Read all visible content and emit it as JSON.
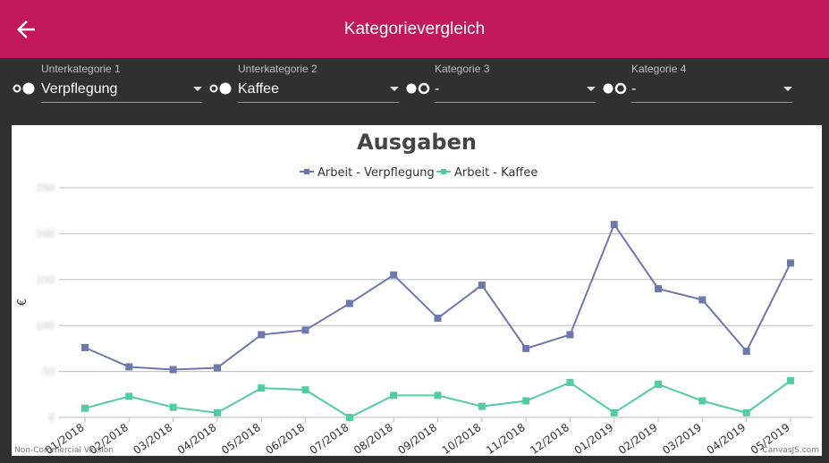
{
  "appbar": {
    "title": "Kategorievergleich",
    "back_icon": "arrow-left-icon",
    "color": "#c2185b"
  },
  "filters": [
    {
      "label": "Unterkategorie 1",
      "value": "Verpflegung",
      "active": true
    },
    {
      "label": "Unterkategorie 2",
      "value": "Kaffee",
      "active": true
    },
    {
      "label": "Kategorie 3",
      "value": "-",
      "active": false
    },
    {
      "label": "Kategorie 4",
      "value": "-",
      "active": false
    }
  ],
  "footer": {
    "left": "Non-Commercial Version",
    "right": "CanvasJS.com"
  },
  "chart_data": {
    "type": "line",
    "title": "Ausgaben",
    "ylabel": "€",
    "categories": [
      "01/2018",
      "02/2018",
      "03/2018",
      "04/2018",
      "05/2018",
      "06/2018",
      "07/2018",
      "08/2018",
      "09/2018",
      "10/2018",
      "11/2018",
      "12/2018",
      "01/2019",
      "02/2019",
      "03/2019",
      "04/2019",
      "05/2019"
    ],
    "ylim": [
      0,
      250
    ],
    "yticks": [
      0,
      50,
      100,
      150,
      200,
      250
    ],
    "ytick_labels_visible": false,
    "grid": true,
    "legend_position": "top-center",
    "series": [
      {
        "name": "Arbeit - Verpflegung",
        "color": "#6d78ad",
        "values": [
          76,
          55,
          52,
          54,
          90,
          95,
          124,
          155,
          108,
          144,
          75,
          90,
          210,
          140,
          128,
          72,
          168
        ]
      },
      {
        "name": "Arbeit - Kaffee",
        "color": "#51cda0",
        "values": [
          10,
          23,
          11,
          5,
          32,
          30,
          0,
          24,
          24,
          12,
          18,
          38,
          5,
          36,
          18,
          5,
          40
        ]
      }
    ]
  }
}
